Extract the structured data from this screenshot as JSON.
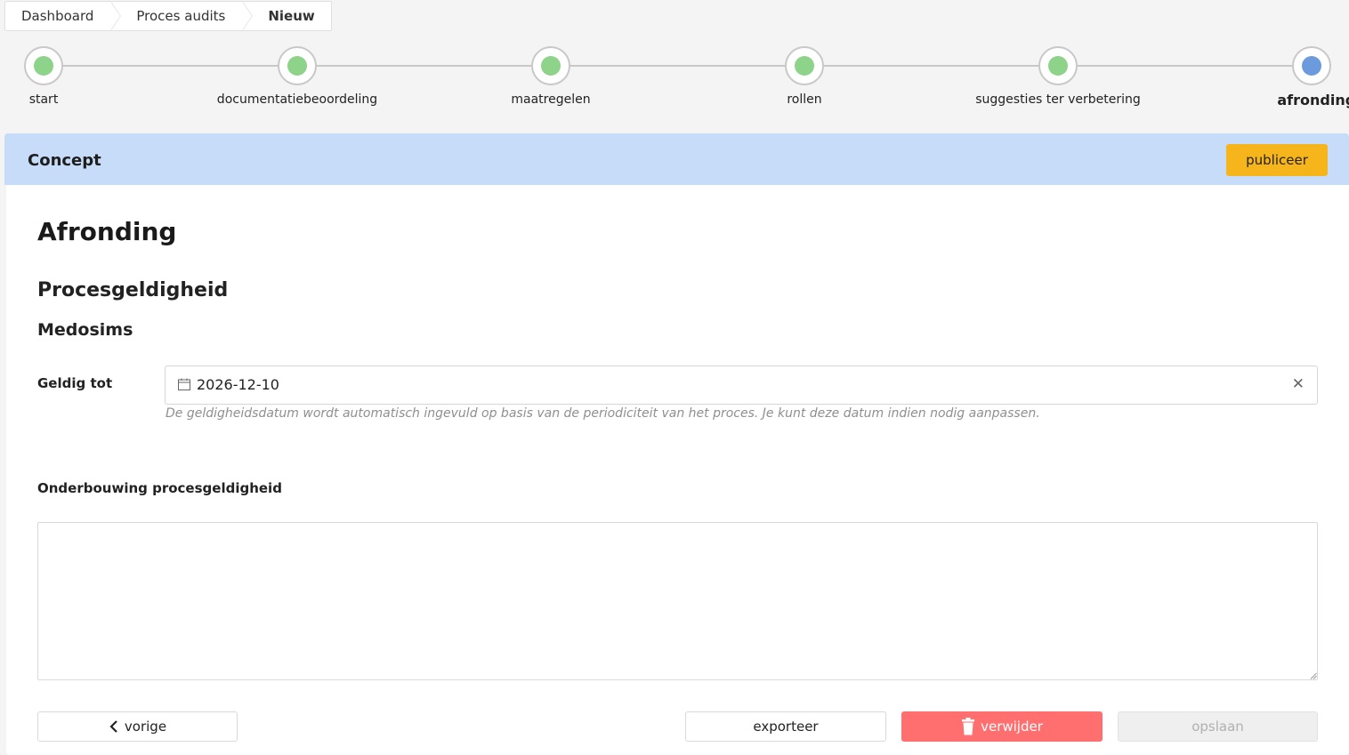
{
  "breadcrumb": {
    "items": [
      "Dashboard",
      "Proces audits",
      "Nieuw"
    ]
  },
  "stepper": {
    "steps": [
      {
        "label": "start",
        "status": "done"
      },
      {
        "label": "documentatiebeoordeling",
        "status": "done"
      },
      {
        "label": "maatregelen",
        "status": "done"
      },
      {
        "label": "rollen",
        "status": "done"
      },
      {
        "label": "suggesties ter verbetering",
        "status": "done"
      },
      {
        "label": "afronding",
        "status": "current"
      }
    ]
  },
  "banner": {
    "title": "Concept",
    "publish_label": "publiceer"
  },
  "main": {
    "title": "Afronding",
    "section_title": "Procesgeldigheid",
    "subsection_title": "Medosims",
    "valid_until_label": "Geldig tot",
    "valid_until_value": "2026-12-10",
    "valid_until_help": "De geldigheidsdatum wordt automatisch ingevuld op basis van de periodiciteit van het proces. Je kunt deze datum indien nodig aanpassen.",
    "justification_label": "Onderbouwing procesgeldigheid",
    "justification_value": ""
  },
  "actions": {
    "prev_label": "vorige",
    "export_label": "exporteer",
    "delete_label": "verwijder",
    "save_label": "opslaan"
  },
  "colors": {
    "done": "#8dd38a",
    "current": "#6b9bdc",
    "banner": "#c7dcf8",
    "publish": "#f7b51c",
    "delete": "#ff6f6f"
  }
}
